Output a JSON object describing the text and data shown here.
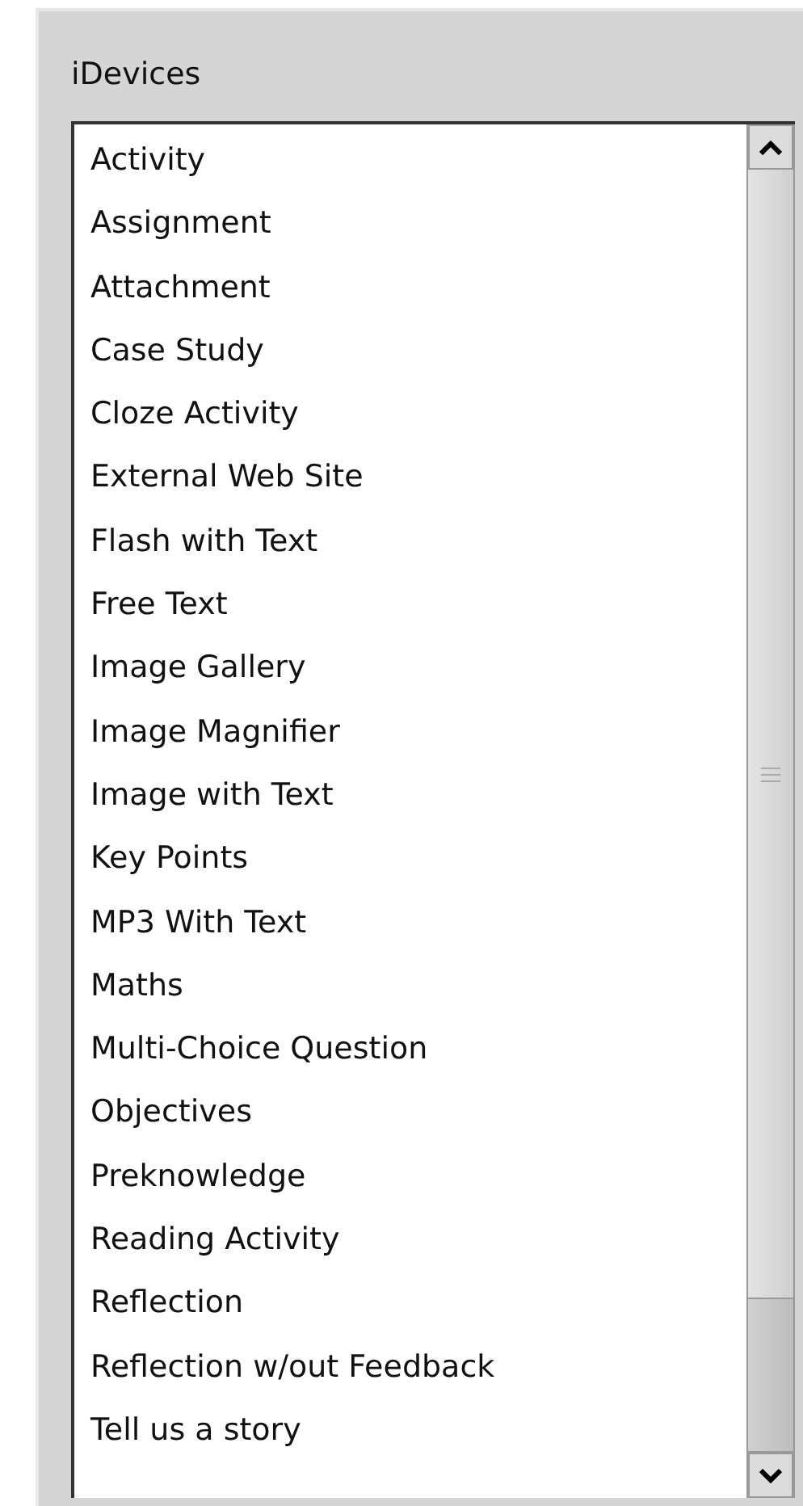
{
  "panel": {
    "title": "iDevices"
  },
  "items": [
    "Activity",
    "Assignment",
    "Attachment",
    "Case Study",
    "Cloze Activity",
    "External Web Site",
    "Flash with Text",
    "Free Text",
    "Image Gallery",
    "Image Magnifier",
    "Image with Text",
    "Key Points",
    "MP3 With Text",
    "Maths",
    "Multi-Choice Question",
    "Objectives",
    "Preknowledge",
    "Reading Activity",
    "Reflection",
    "Reflection w/out Feedback",
    "Tell us a story"
  ]
}
